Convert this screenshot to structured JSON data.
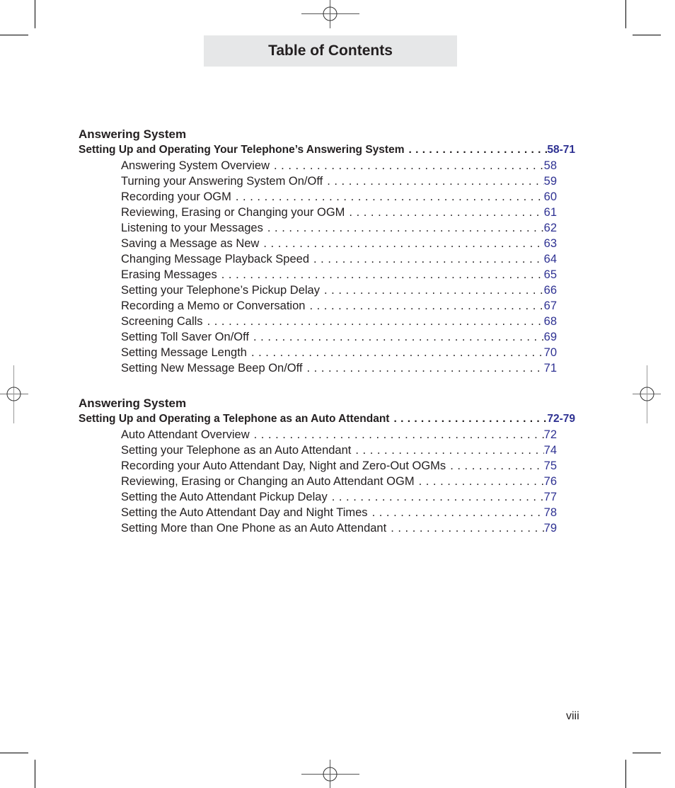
{
  "header": {
    "title": "Table of Contents"
  },
  "sections": [
    {
      "heading": "Answering System",
      "chapter": {
        "label": "Setting Up and Operating Your Telephone’s Answering System",
        "page": "58-71"
      },
      "items": [
        {
          "label": "Answering System Overview",
          "page": "58"
        },
        {
          "label": "Turning your Answering System On/Off",
          "page": "59"
        },
        {
          "label": "Recording your OGM",
          "page": "60"
        },
        {
          "label": "Reviewing, Erasing or Changing your OGM",
          "page": "61"
        },
        {
          "label": "Listening to your Messages",
          "page": "62"
        },
        {
          "label": "Saving a Message as New",
          "page": "63"
        },
        {
          "label": "Changing Message Playback Speed",
          "page": "64"
        },
        {
          "label": "Erasing Messages",
          "page": "65"
        },
        {
          "label": "Setting your Telephone’s Pickup Delay",
          "page": "66"
        },
        {
          "label": "Recording a Memo or Conversation",
          "page": "67"
        },
        {
          "label": "Screening Calls",
          "page": "68"
        },
        {
          "label": "Setting Toll Saver On/Off",
          "page": "69"
        },
        {
          "label": "Setting Message Length",
          "page": "70"
        },
        {
          "label": "Setting New Message Beep On/Off",
          "page": "71"
        }
      ]
    },
    {
      "heading": "Answering System",
      "chapter": {
        "label": "Setting Up and Operating a Telephone as an Auto Attendant",
        "page": "72-79"
      },
      "items": [
        {
          "label": "Auto Attendant Overview",
          "page": "72"
        },
        {
          "label": "Setting your Telephone as an Auto Attendant",
          "page": "74"
        },
        {
          "label": "Recording your Auto Attendant Day, Night and Zero-Out OGMs",
          "page": "75"
        },
        {
          "label": "Reviewing, Erasing or Changing an Auto Attendant OGM",
          "page": "76"
        },
        {
          "label": "Setting the Auto Attendant Pickup Delay",
          "page": "77"
        },
        {
          "label": "Setting the Auto Attendant Day and Night Times",
          "page": "78"
        },
        {
          "label": "Setting More than One Phone as an Auto Attendant",
          "page": "79"
        }
      ]
    }
  ],
  "footer": {
    "folio": "viii"
  },
  "colors": {
    "page_number": "#2e3192",
    "title_band": "#e6e7e8",
    "text": "#231f20"
  }
}
